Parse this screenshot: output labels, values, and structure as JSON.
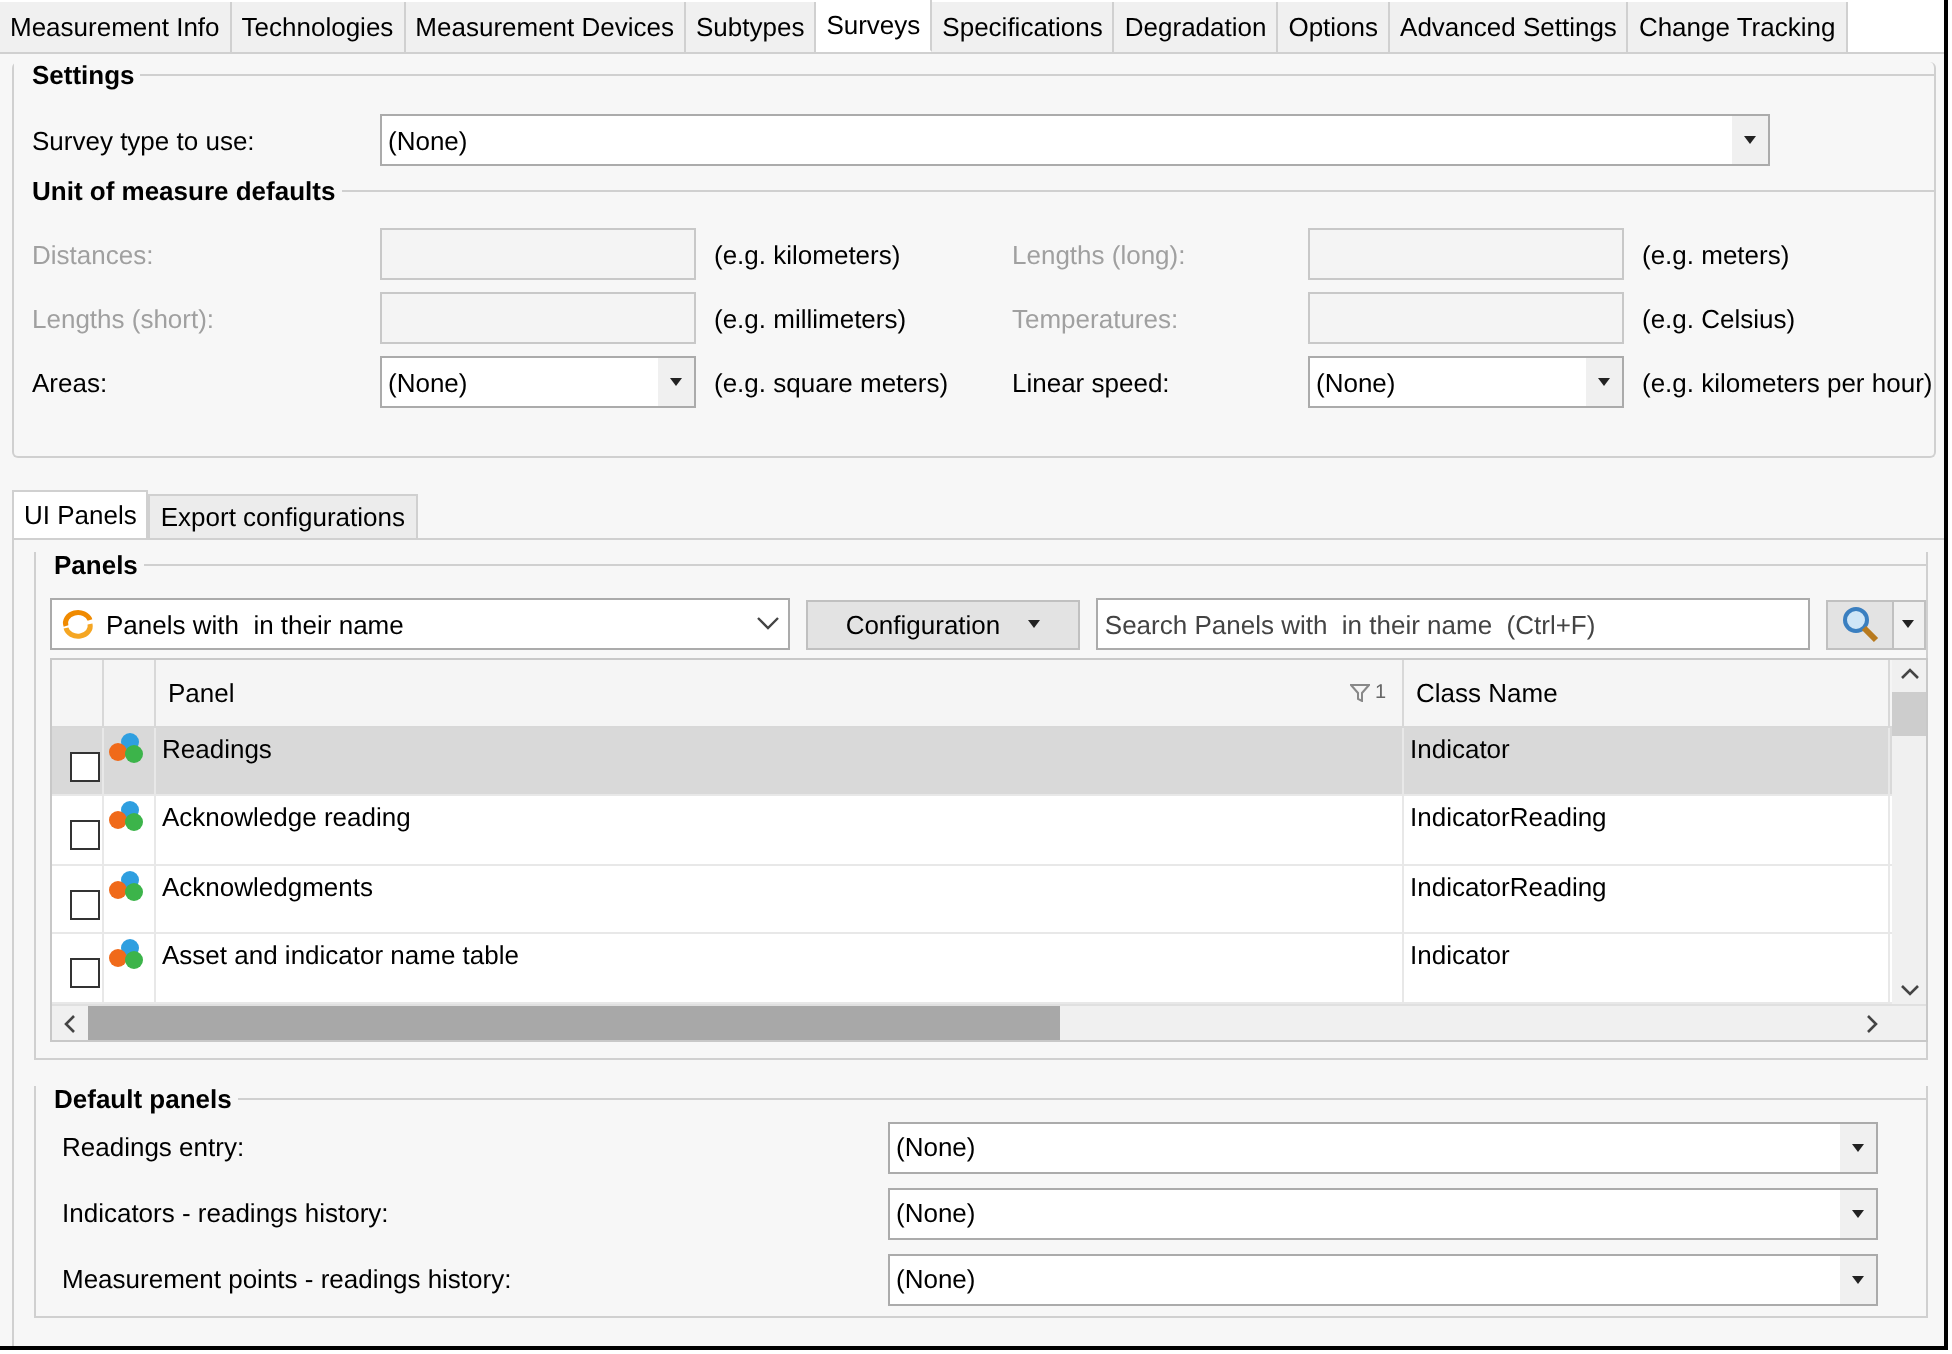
{
  "tabs": [
    {
      "label": "Measurement Info",
      "selected": false
    },
    {
      "label": "Technologies",
      "selected": false
    },
    {
      "label": "Measurement Devices",
      "selected": false
    },
    {
      "label": "Subtypes",
      "selected": false
    },
    {
      "label": "Surveys",
      "selected": true
    },
    {
      "label": "Specifications",
      "selected": false
    },
    {
      "label": "Degradation",
      "selected": false
    },
    {
      "label": "Options",
      "selected": false
    },
    {
      "label": "Advanced Settings",
      "selected": false
    },
    {
      "label": "Change Tracking",
      "selected": false
    }
  ],
  "settings": {
    "title": "Settings",
    "survey_type": {
      "label": "Survey type to use:",
      "value": "(None)"
    }
  },
  "unit_defaults": {
    "title": "Unit of measure defaults",
    "fields": [
      {
        "label": "Distances:",
        "kind": "text",
        "disabled": true,
        "hint": "(e.g. kilometers)"
      },
      {
        "label": "Lengths (long):",
        "kind": "text",
        "disabled": true,
        "hint": "(e.g. meters)"
      },
      {
        "label": "Lengths (short):",
        "kind": "text",
        "disabled": true,
        "hint": "(e.g. millimeters)"
      },
      {
        "label": "Temperatures:",
        "kind": "text",
        "disabled": true,
        "hint": "(e.g. Celsius)"
      },
      {
        "label": "Areas:",
        "kind": "dropdown",
        "disabled": false,
        "value": "(None)",
        "hint": "(e.g. square meters)"
      },
      {
        "label": "Linear speed:",
        "kind": "dropdown",
        "disabled": false,
        "value": "(None)",
        "hint": "(e.g. kilometers per hour)"
      }
    ]
  },
  "sub_tabs": [
    {
      "label": "UI Panels",
      "selected": true
    },
    {
      "label": "Export configurations",
      "selected": false
    }
  ],
  "panels": {
    "title": "Panels",
    "filter": "Panels with  in their name",
    "configuration_button": "Configuration",
    "search": {
      "placeholder": "Search Panels with  in their name  (Ctrl+F)"
    },
    "table": {
      "columns": [
        "Panel",
        "Class Name"
      ],
      "sort_indicator": "1",
      "rows": [
        {
          "panel": "Readings",
          "class_name": "Indicator",
          "selected": true,
          "checked": false
        },
        {
          "panel": "Acknowledge reading",
          "class_name": "IndicatorReading",
          "selected": false,
          "checked": false
        },
        {
          "panel": "Acknowledgments",
          "class_name": "IndicatorReading",
          "selected": false,
          "checked": false
        },
        {
          "panel": "Asset and indicator name table",
          "class_name": "Indicator",
          "selected": false,
          "checked": false
        }
      ]
    }
  },
  "default_panels": {
    "title": "Default panels",
    "fields": [
      {
        "label": "Readings entry:",
        "value": "(None)"
      },
      {
        "label": "Indicators - readings history:",
        "value": "(None)"
      },
      {
        "label": "Measurement points - readings history:",
        "value": "(None)"
      }
    ]
  }
}
